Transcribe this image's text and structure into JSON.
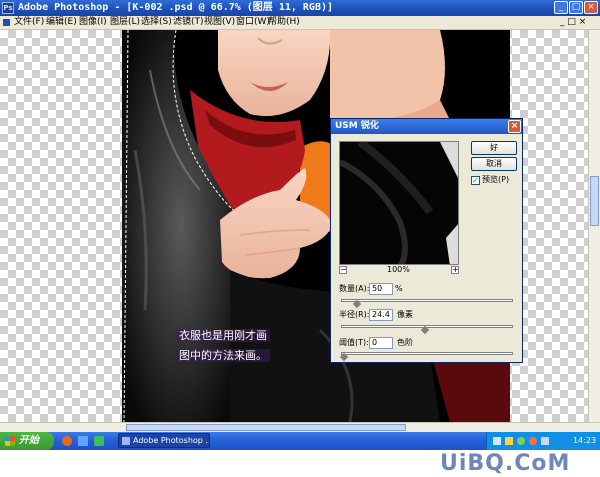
{
  "window": {
    "title": "Adobe Photoshop - [K-002 .psd @ 66.7% (图层 11, RGB)]",
    "app_icon_text": "Ps",
    "min_label": "_",
    "max_label": "□",
    "close_label": "×"
  },
  "menu": [
    "文件(F)",
    "编辑(E)",
    "图像(I)",
    "图层(L)",
    "选择(S)",
    "滤镜(T)",
    "视图(V)",
    "窗口(W)",
    "帮助(H)"
  ],
  "caption": [
    "衣服也是用刚才画",
    "图中的方法来画。"
  ],
  "dialog": {
    "title": "USM 锐化",
    "close_label": "×",
    "ok_label": "好",
    "cancel_label": "取消",
    "preview_label": "预览(P)",
    "preview_checked": true,
    "zoom_out": "−",
    "zoom_in": "+",
    "zoom_level": "100%",
    "amount_label": "数量(A):",
    "amount_value": "50",
    "amount_unit": "%",
    "amount_slider": 0.08,
    "radius_label": "半径(R):",
    "radius_value": "24.4",
    "radius_unit": "像素",
    "radius_slider": 0.49,
    "threshold_label": "阈值(T):",
    "threshold_value": "0",
    "threshold_unit": "色阶",
    "threshold_slider": 0.0
  },
  "taskbar": {
    "start_label": "开始",
    "task_label": "Adobe Photoshop ...",
    "clock": "14:23"
  },
  "watermark": "UiBQ.CoM",
  "colors": {
    "titlebar": "#1b4fb6",
    "taskbar": "#245ed6",
    "start": "#3a9a2f"
  }
}
